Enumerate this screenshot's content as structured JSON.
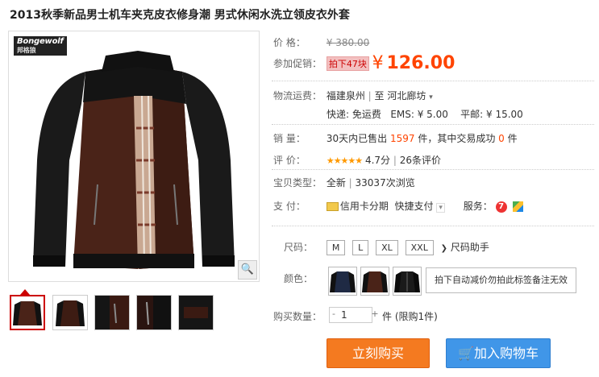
{
  "product": {
    "title": "2013秋季新品男士机车夹克皮衣修身潮 男式休闲水洗立领皮衣外套",
    "brand_logo": "Bongewolf",
    "brand_logo_sub": "邦格狼"
  },
  "price": {
    "label": "价    格：",
    "original": "¥ 380.00",
    "promo_label": "参加促销：",
    "promo_tag": "拍下47块",
    "currency": "¥",
    "promo_price": "126.00"
  },
  "shipping": {
    "label": "物流运费：",
    "from": "福建泉州",
    "to_word": "至",
    "to": "河北廊坊",
    "express": "快递: 免运费",
    "ems": "EMS: ¥ 5.00",
    "mail": "平邮: ¥ 15.00"
  },
  "sales": {
    "label": "销    量：",
    "prefix": "30天内已售出",
    "sold": "1597",
    "mid": "件，其中交易成功",
    "success": "0",
    "suffix": "件"
  },
  "rating": {
    "label": "评    价：",
    "stars": "★★★★★",
    "score": "4.7分",
    "reviews": "26条评价"
  },
  "item_type": {
    "label": "宝贝类型：",
    "value": "全新",
    "views": "33037次浏览"
  },
  "payment": {
    "label": "支    付：",
    "credit": "信用卡分期",
    "quick": "快捷支付",
    "service_label": "服务："
  },
  "options": {
    "size_label": "尺码：",
    "sizes": [
      "M",
      "L",
      "XL",
      "XXL"
    ],
    "size_helper": "尺码助手",
    "color_label": "颜色：",
    "color_note": "拍下自动减价勿拍此标签备注无效",
    "qty_label": "购买数量：",
    "qty_value": "1",
    "qty_unit": "件 (限购1件)"
  },
  "buttons": {
    "buy": "立刻购买",
    "cart": "加入购物车"
  },
  "colors": {
    "accent": "#ff4400",
    "buy_bg": "#f47a20",
    "cart_bg": "#4096e8"
  }
}
